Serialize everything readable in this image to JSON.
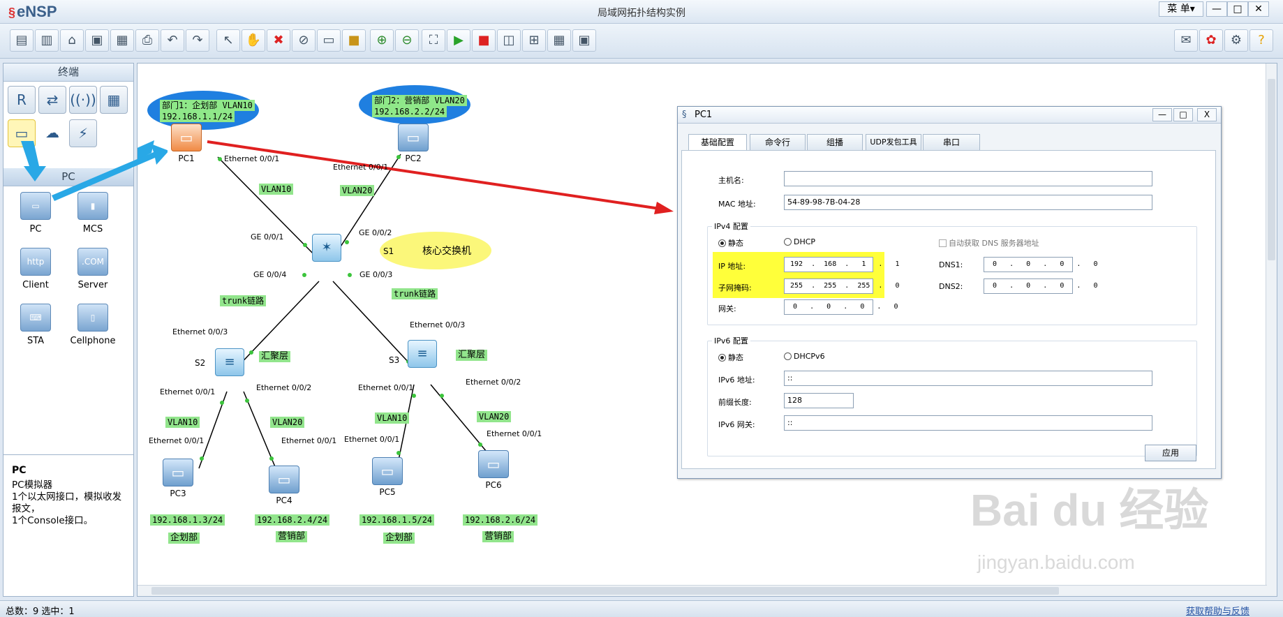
{
  "app": {
    "logo": "eNSP",
    "title": "局域网拓扑结构实例",
    "menu": "菜 单▾",
    "win_min": "—",
    "win_max": "□",
    "win_close": "✕"
  },
  "toolbar": {
    "icons": [
      "new-topo",
      "new-example",
      "open",
      "save",
      "save-as",
      "print",
      "undo",
      "redo",
      "select",
      "pan",
      "delete",
      "delete-all",
      "text-note",
      "rectangle",
      "zoom-in",
      "zoom-out",
      "fit",
      "start",
      "stop",
      "capture",
      "topology",
      "grid",
      "screenshot"
    ],
    "right_icons": [
      "forum",
      "huawei",
      "settings",
      "help"
    ]
  },
  "left": {
    "terminal_header": "终端",
    "pc_header": "PC",
    "devices": [
      {
        "label": "PC",
        "icon": "pc-icon"
      },
      {
        "label": "MCS",
        "icon": "mcs-icon"
      },
      {
        "label": "Client",
        "icon": "client-icon"
      },
      {
        "label": "Server",
        "icon": "server-icon"
      },
      {
        "label": "STA",
        "icon": "sta-icon"
      },
      {
        "label": "Cellphone",
        "icon": "cellphone-icon"
      }
    ],
    "desc_title": "PC",
    "desc_text": "PC模拟器\n1个以太网接口，模拟收发报文，\n1个Console接口。"
  },
  "topo": {
    "dept1": [
      "部门1：企划部 VLAN10",
      "192.168.1.1/24"
    ],
    "dept2": [
      "部门2：营销部 VLAN20",
      "192.168.2.2/24"
    ],
    "core_s1": "S1",
    "core_label": "核心交换机",
    "nodes": {
      "pc1": "PC1",
      "pc2": "PC2",
      "pc3": "PC3",
      "pc4": "PC4",
      "pc5": "PC5",
      "pc6": "PC6",
      "s2": "S2",
      "s3": "S3"
    },
    "ports": {
      "pc1": "Ethernet 0/0/1",
      "pc2": "Ethernet 0/0/1",
      "s1_1": "GE 0/0/1",
      "s1_2": "GE 0/0/2",
      "s1_4": "GE 0/0/4",
      "s1_3": "GE 0/0/3",
      "s2_3": "Ethernet 0/0/3",
      "s3_3": "Ethernet 0/0/3",
      "s2_1": "Ethernet 0/0/1",
      "s2_2": "Ethernet 0/0/2",
      "s3_1": "Ethernet 0/0/1",
      "s3_2": "Ethernet 0/0/2",
      "pc3": "Ethernet 0/0/1",
      "pc4": "Ethernet 0/0/1",
      "pc5": "Ethernet 0/0/1",
      "pc6": "Ethernet 0/0/1"
    },
    "tags": {
      "v10a": "VLAN10",
      "v20a": "VLAN20",
      "trunk1": "trunk链路",
      "trunk2": "trunk链路",
      "agg1": "汇聚层",
      "agg2": "汇聚层",
      "v10b": "VLAN10",
      "v20b": "VLAN20",
      "v10c": "VLAN10",
      "v20c": "VLAN20"
    },
    "ips": {
      "pc3": "192.168.1.3/24",
      "pc4": "192.168.2.4/24",
      "pc5": "192.168.1.5/24",
      "pc6": "192.168.2.6/24"
    },
    "depts": {
      "pc3": "企划部",
      "pc4": "营销部",
      "pc5": "企划部",
      "pc6": "营销部"
    }
  },
  "dialog": {
    "title": "PC1",
    "min": "—",
    "max": "□",
    "close": "X",
    "tabs": [
      "基础配置",
      "命令行",
      "组播",
      "UDP发包工具",
      "串口"
    ],
    "hostname_label": "主机名:",
    "hostname": "",
    "mac_label": "MAC 地址:",
    "mac": "54-89-98-7B-04-28",
    "ipv4_legend": "IPv4 配置",
    "static": "静态",
    "dhcp": "DHCP",
    "auto_dns": "自动获取 DNS 服务器地址",
    "ip_label": "IP 地址:",
    "ip": "192  .  168  .   1   .   1",
    "mask_label": "子网掩码:",
    "mask": "255  .  255  .  255  .   0",
    "gw_label": "网关:",
    "gw": "0   .   0   .   0   .   0",
    "dns1_label": "DNS1:",
    "dns1": "0   .   0   .   0   .   0",
    "dns2_label": "DNS2:",
    "dns2": "0   .   0   .   0   .   0",
    "ipv6_legend": "IPv6 配置",
    "static6": "静态",
    "dhcpv6": "DHCPv6",
    "ipv6_label": "IPv6 地址:",
    "ipv6": "::",
    "prefix_label": "前缀长度:",
    "prefix": "128",
    "gw6_label": "IPv6 网关:",
    "gw6": "::",
    "apply": "应用"
  },
  "status": {
    "left": "总数：9  选中：1",
    "right": "获取帮助与反馈"
  },
  "watermark": {
    "main": "Bai du 经验",
    "sub": "jingyan.baidu.com"
  },
  "colors": {
    "highlight": "#ffff3a",
    "green_tag": "#92e58c",
    "dept_ellipse": "#1f7fe0",
    "core_ellipse": "#fbf77a",
    "red_arrow": "#e02020",
    "blue_arrow": "#29a8e6"
  }
}
